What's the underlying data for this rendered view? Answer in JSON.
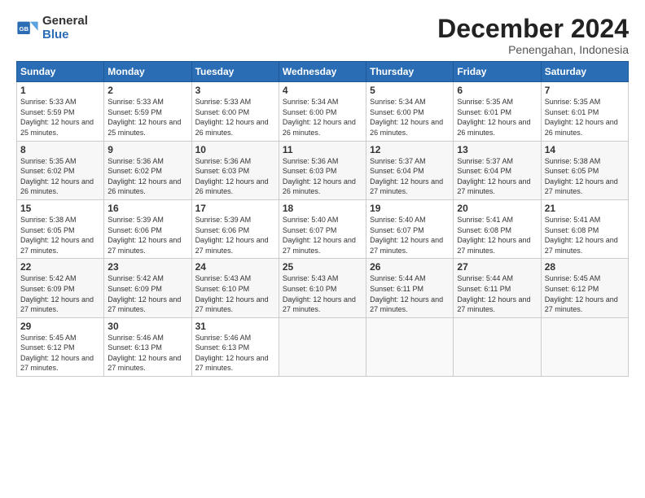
{
  "logo": {
    "general": "General",
    "blue": "Blue"
  },
  "header": {
    "month": "December 2024",
    "location": "Penengahan, Indonesia"
  },
  "weekdays": [
    "Sunday",
    "Monday",
    "Tuesday",
    "Wednesday",
    "Thursday",
    "Friday",
    "Saturday"
  ],
  "weeks": [
    [
      {
        "day": "1",
        "rise": "5:33 AM",
        "set": "5:59 PM",
        "daylight": "12 hours and 25 minutes."
      },
      {
        "day": "2",
        "rise": "5:33 AM",
        "set": "5:59 PM",
        "daylight": "12 hours and 25 minutes."
      },
      {
        "day": "3",
        "rise": "5:33 AM",
        "set": "6:00 PM",
        "daylight": "12 hours and 26 minutes."
      },
      {
        "day": "4",
        "rise": "5:34 AM",
        "set": "6:00 PM",
        "daylight": "12 hours and 26 minutes."
      },
      {
        "day": "5",
        "rise": "5:34 AM",
        "set": "6:00 PM",
        "daylight": "12 hours and 26 minutes."
      },
      {
        "day": "6",
        "rise": "5:35 AM",
        "set": "6:01 PM",
        "daylight": "12 hours and 26 minutes."
      },
      {
        "day": "7",
        "rise": "5:35 AM",
        "set": "6:01 PM",
        "daylight": "12 hours and 26 minutes."
      }
    ],
    [
      {
        "day": "8",
        "rise": "5:35 AM",
        "set": "6:02 PM",
        "daylight": "12 hours and 26 minutes."
      },
      {
        "day": "9",
        "rise": "5:36 AM",
        "set": "6:02 PM",
        "daylight": "12 hours and 26 minutes."
      },
      {
        "day": "10",
        "rise": "5:36 AM",
        "set": "6:03 PM",
        "daylight": "12 hours and 26 minutes."
      },
      {
        "day": "11",
        "rise": "5:36 AM",
        "set": "6:03 PM",
        "daylight": "12 hours and 26 minutes."
      },
      {
        "day": "12",
        "rise": "5:37 AM",
        "set": "6:04 PM",
        "daylight": "12 hours and 27 minutes."
      },
      {
        "day": "13",
        "rise": "5:37 AM",
        "set": "6:04 PM",
        "daylight": "12 hours and 27 minutes."
      },
      {
        "day": "14",
        "rise": "5:38 AM",
        "set": "6:05 PM",
        "daylight": "12 hours and 27 minutes."
      }
    ],
    [
      {
        "day": "15",
        "rise": "5:38 AM",
        "set": "6:05 PM",
        "daylight": "12 hours and 27 minutes."
      },
      {
        "day": "16",
        "rise": "5:39 AM",
        "set": "6:06 PM",
        "daylight": "12 hours and 27 minutes."
      },
      {
        "day": "17",
        "rise": "5:39 AM",
        "set": "6:06 PM",
        "daylight": "12 hours and 27 minutes."
      },
      {
        "day": "18",
        "rise": "5:40 AM",
        "set": "6:07 PM",
        "daylight": "12 hours and 27 minutes."
      },
      {
        "day": "19",
        "rise": "5:40 AM",
        "set": "6:07 PM",
        "daylight": "12 hours and 27 minutes."
      },
      {
        "day": "20",
        "rise": "5:41 AM",
        "set": "6:08 PM",
        "daylight": "12 hours and 27 minutes."
      },
      {
        "day": "21",
        "rise": "5:41 AM",
        "set": "6:08 PM",
        "daylight": "12 hours and 27 minutes."
      }
    ],
    [
      {
        "day": "22",
        "rise": "5:42 AM",
        "set": "6:09 PM",
        "daylight": "12 hours and 27 minutes."
      },
      {
        "day": "23",
        "rise": "5:42 AM",
        "set": "6:09 PM",
        "daylight": "12 hours and 27 minutes."
      },
      {
        "day": "24",
        "rise": "5:43 AM",
        "set": "6:10 PM",
        "daylight": "12 hours and 27 minutes."
      },
      {
        "day": "25",
        "rise": "5:43 AM",
        "set": "6:10 PM",
        "daylight": "12 hours and 27 minutes."
      },
      {
        "day": "26",
        "rise": "5:44 AM",
        "set": "6:11 PM",
        "daylight": "12 hours and 27 minutes."
      },
      {
        "day": "27",
        "rise": "5:44 AM",
        "set": "6:11 PM",
        "daylight": "12 hours and 27 minutes."
      },
      {
        "day": "28",
        "rise": "5:45 AM",
        "set": "6:12 PM",
        "daylight": "12 hours and 27 minutes."
      }
    ],
    [
      {
        "day": "29",
        "rise": "5:45 AM",
        "set": "6:12 PM",
        "daylight": "12 hours and 27 minutes."
      },
      {
        "day": "30",
        "rise": "5:46 AM",
        "set": "6:13 PM",
        "daylight": "12 hours and 27 minutes."
      },
      {
        "day": "31",
        "rise": "5:46 AM",
        "set": "6:13 PM",
        "daylight": "12 hours and 27 minutes."
      },
      null,
      null,
      null,
      null
    ]
  ]
}
